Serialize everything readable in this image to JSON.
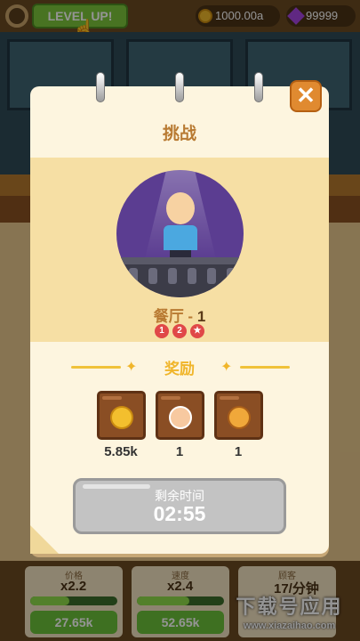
{
  "hud": {
    "level_up_label": "LEVEL UP!",
    "coins": "1000.00a",
    "gems": "99999"
  },
  "modal": {
    "title": "挑战",
    "restaurant_label": "餐厅 - ",
    "restaurant_num": "1",
    "stages": [
      "1",
      "2",
      "★"
    ],
    "reward_title": "奖励",
    "rewards": [
      {
        "icon": "gold-coin-icon",
        "value": "5.85k"
      },
      {
        "icon": "chef-icon",
        "value": "1"
      },
      {
        "icon": "burger-icon",
        "value": "1"
      }
    ],
    "timer_label": "剩余时间",
    "timer_value": "02:55",
    "close_glyph": "✕"
  },
  "bottom": [
    {
      "title": "价格",
      "value": "x2.2",
      "progress": 0.45,
      "button": "27.65k"
    },
    {
      "title": "速度",
      "value": "x2.4",
      "progress": 0.6,
      "button": "52.65k"
    },
    {
      "title": "顾客",
      "value": "17/分钟",
      "progress": 0.0,
      "button": ""
    }
  ],
  "watermark": {
    "line1": "下载号应用",
    "line2": "www.xiazaihao.com"
  },
  "colors": {
    "accent": "#b87a32",
    "reward": "#f0b52a",
    "close": "#e08a30"
  }
}
